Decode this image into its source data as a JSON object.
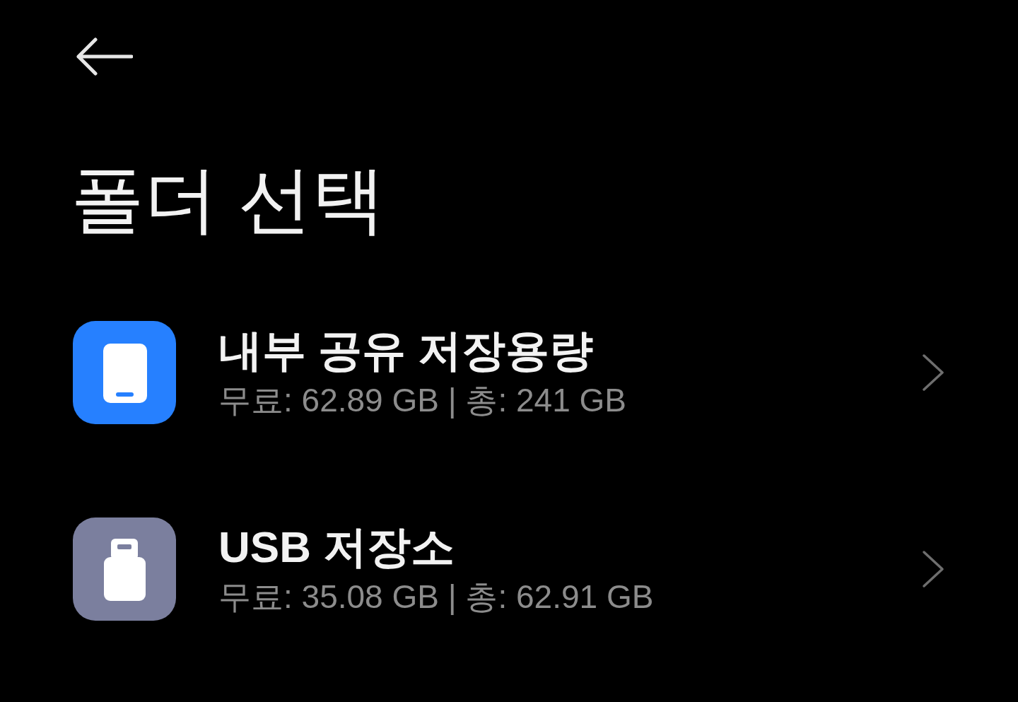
{
  "title": "폴더 선택",
  "storages": [
    {
      "kind": "internal",
      "name": "내부 공유 저장용량",
      "detail": "무료: 62.89 GB | 총: 241 GB"
    },
    {
      "kind": "usb",
      "name": "USB 저장소",
      "detail": "무료: 35.08 GB | 총: 62.91 GB"
    }
  ]
}
